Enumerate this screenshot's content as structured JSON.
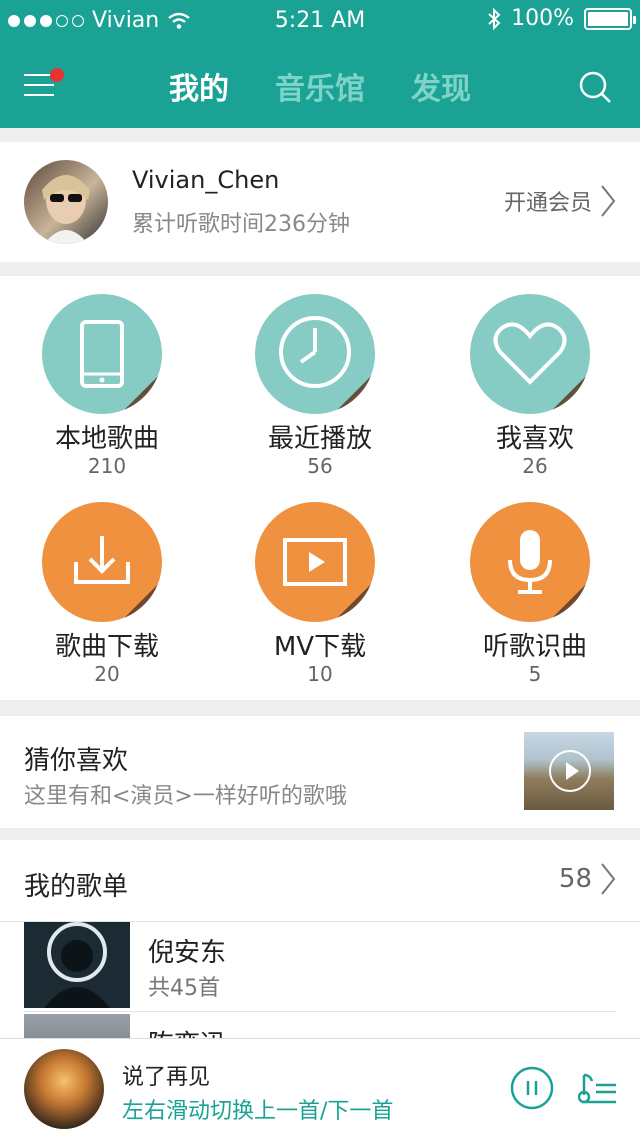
{
  "colors": {
    "primary": "#1aa395",
    "tab_inactive": "#7fd3c8",
    "teal_circle": "#86ccc5",
    "orange_circle": "#f0913f",
    "notify_dot": "#e8322f"
  },
  "status_bar": {
    "carrier": "Vivian",
    "time": "5:21 AM",
    "battery": "100%"
  },
  "nav": {
    "tabs": [
      "我的",
      "音乐馆",
      "发现"
    ],
    "active_tab": "我的"
  },
  "profile": {
    "name": "Vivian_Chen",
    "subtitle": "累计听歌时间236分钟",
    "vip_label": "开通会员"
  },
  "grid": [
    {
      "label": "本地歌曲",
      "count": "210",
      "icon": "phone-icon"
    },
    {
      "label": "最近播放",
      "count": "56",
      "icon": "clock-icon"
    },
    {
      "label": "我喜欢",
      "count": "26",
      "icon": "heart-icon"
    },
    {
      "label": "歌曲下载",
      "count": "20",
      "icon": "download-icon"
    },
    {
      "label": "MV下载",
      "count": "10",
      "icon": "video-icon"
    },
    {
      "label": "听歌识曲",
      "count": "5",
      "icon": "microphone-icon"
    }
  ],
  "recommend": {
    "title": "猜你喜欢",
    "subtitle": "这里有和<演员>一样好听的歌哦"
  },
  "playlists": {
    "title": "我的歌单",
    "count": "58",
    "items": [
      {
        "name": "倪安东",
        "sub": "共45首"
      },
      {
        "name": "陈奕迅",
        "sub": ""
      }
    ]
  },
  "player": {
    "track": "说了再见",
    "hint": "左右滑动切换上一首/下一首"
  }
}
